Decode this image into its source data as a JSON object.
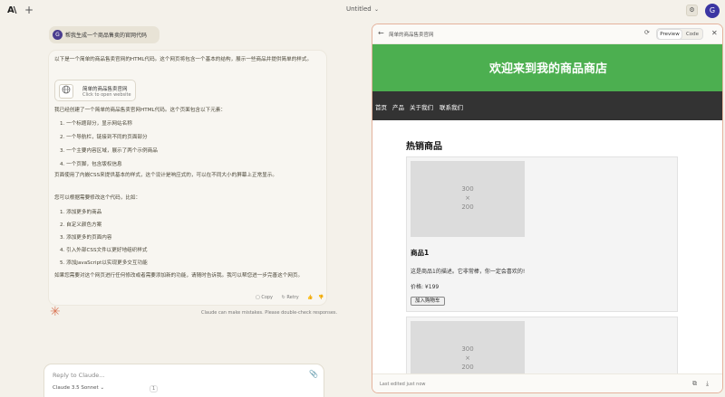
{
  "app": {
    "logo": "A\\",
    "new_label": "+"
  },
  "header": {
    "title": "Untitled",
    "title_chevron": "⌄",
    "settings_glyph": "⚙",
    "avatar_initial": "G"
  },
  "chat": {
    "user_message": {
      "avatar_initial": "G",
      "text": "帮我生成一个商品售卖的官网代码"
    },
    "ai": {
      "intro": "以下是一个简单的商品售卖官网的HTML代码。这个网页将包含一个基本的结构，展示一些商品并提供简单的样式。",
      "artifact": {
        "title": "简单的商品售卖官网",
        "subtitle": "Click to open website",
        "icon": "globe-icon"
      },
      "summary": "我已经创建了一个简单的商品售卖官网HTML代码。这个页面包含以下元素：",
      "elements": [
        "1.  一个标题部分，显示网站名称",
        "2.  一个导航栏，链接到不同的页面部分",
        "3.  一个主要内容区域，展示了两个示例商品",
        "4.  一个页脚，包含版权信息"
      ],
      "css_note": "页面使用了内嵌CSS来提供基本的样式，这个设计是响应式的，可以在不同大小的屏幕上正常显示。",
      "extend_intro": "您可以根据需要修改这个代码，比如：",
      "suggestions": [
        "1.  添加更多的商品",
        "2.  自定义颜色方案",
        "3.  添加更多的页面内容",
        "4.  引入外部CSS文件以更好地组织样式",
        "5.  添加JavaScript以实现更多交互功能"
      ],
      "closing": "如果您需要对这个网页进行任何修改或者需要添加新的功能，请随时告诉我。我可以帮您进一步完善这个网页。",
      "actions": {
        "copy": "Copy",
        "retry": "Retry"
      }
    },
    "disclaimer": "Claude can make mistakes. Please double-check responses."
  },
  "composer": {
    "placeholder": "Reply to Claude...",
    "model": "Claude 3.5 Sonnet ⌄",
    "count": "1"
  },
  "panel": {
    "title": "简单的商品售卖官网",
    "toggle": {
      "preview": "Preview",
      "code": "Code",
      "selected": "preview"
    },
    "footer_text": "Last edited just now",
    "site": {
      "hero_title": "欢迎来到我的商品商店",
      "nav": [
        "首页",
        "产品",
        "关于我们",
        "联系我们"
      ],
      "section_title": "热销商品",
      "products": [
        {
          "placeholder_w": "300",
          "placeholder_x": "×",
          "placeholder_h": "200",
          "name": "商品1",
          "description": "这是商品1的描述。它非常棒，你一定会喜欢的!",
          "price": "价格: ¥199",
          "button": "加入购物车"
        },
        {
          "placeholder_w": "300",
          "placeholder_x": "×",
          "placeholder_h": "200"
        }
      ]
    }
  },
  "colors": {
    "accent": "#4caf50",
    "nav_bg": "#333333",
    "panel_border": "#e4b29c",
    "page_bg": "#f4f1ea"
  }
}
